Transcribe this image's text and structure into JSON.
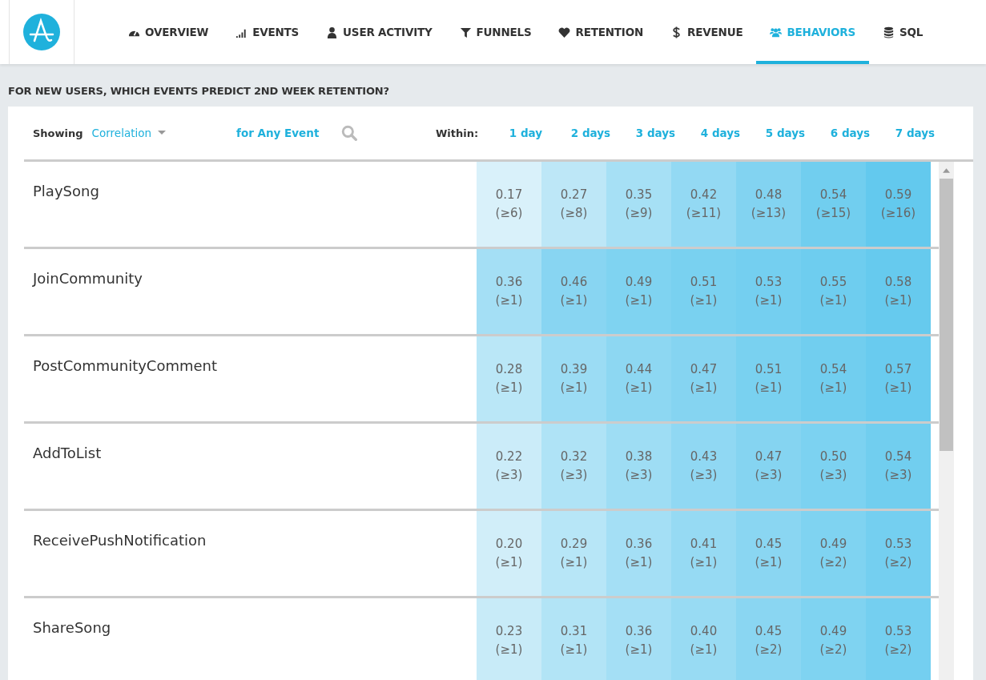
{
  "nav": [
    {
      "label": "OVERVIEW",
      "kind": "gauge",
      "selected": false
    },
    {
      "label": "EVENTS",
      "kind": "bars",
      "selected": false
    },
    {
      "label": "USER ACTIVITY",
      "kind": "user",
      "selected": false
    },
    {
      "label": "FUNNELS",
      "kind": "funnel",
      "selected": false
    },
    {
      "label": "RETENTION",
      "kind": "heart",
      "selected": false
    },
    {
      "label": "REVENUE",
      "kind": "dollar",
      "selected": false
    },
    {
      "label": "BEHAVIORS",
      "kind": "users",
      "selected": true
    },
    {
      "label": "SQL",
      "kind": "database",
      "selected": false
    }
  ],
  "heading": "FOR NEW USERS, WHICH EVENTS PREDICT 2ND WEEK RETENTION?",
  "toolbar": {
    "showing_label": "Showing",
    "metric": "Correlation",
    "event_filter": "for Any Event",
    "within_label": "Within:"
  },
  "columns": [
    "1 day",
    "2 days",
    "3 days",
    "4 days",
    "5 days",
    "6 days",
    "7 days"
  ],
  "rows": [
    {
      "event": "PlaySong",
      "cells": [
        [
          "0.17",
          "(≥6)"
        ],
        [
          "0.27",
          "(≥8)"
        ],
        [
          "0.35",
          "(≥9)"
        ],
        [
          "0.42",
          "(≥11)"
        ],
        [
          "0.48",
          "(≥13)"
        ],
        [
          "0.54",
          "(≥15)"
        ],
        [
          "0.59",
          "(≥16)"
        ]
      ]
    },
    {
      "event": "JoinCommunity",
      "cells": [
        [
          "0.36",
          "(≥1)"
        ],
        [
          "0.46",
          "(≥1)"
        ],
        [
          "0.49",
          "(≥1)"
        ],
        [
          "0.51",
          "(≥1)"
        ],
        [
          "0.53",
          "(≥1)"
        ],
        [
          "0.55",
          "(≥1)"
        ],
        [
          "0.58",
          "(≥1)"
        ]
      ]
    },
    {
      "event": "PostCommunityComment",
      "cells": [
        [
          "0.28",
          "(≥1)"
        ],
        [
          "0.39",
          "(≥1)"
        ],
        [
          "0.44",
          "(≥1)"
        ],
        [
          "0.47",
          "(≥1)"
        ],
        [
          "0.51",
          "(≥1)"
        ],
        [
          "0.54",
          "(≥1)"
        ],
        [
          "0.57",
          "(≥1)"
        ]
      ]
    },
    {
      "event": "AddToList",
      "cells": [
        [
          "0.22",
          "(≥3)"
        ],
        [
          "0.32",
          "(≥3)"
        ],
        [
          "0.38",
          "(≥3)"
        ],
        [
          "0.43",
          "(≥3)"
        ],
        [
          "0.47",
          "(≥3)"
        ],
        [
          "0.50",
          "(≥3)"
        ],
        [
          "0.54",
          "(≥3)"
        ]
      ]
    },
    {
      "event": "ReceivePushNotification",
      "cells": [
        [
          "0.20",
          "(≥1)"
        ],
        [
          "0.29",
          "(≥1)"
        ],
        [
          "0.36",
          "(≥1)"
        ],
        [
          "0.41",
          "(≥1)"
        ],
        [
          "0.45",
          "(≥1)"
        ],
        [
          "0.49",
          "(≥2)"
        ],
        [
          "0.53",
          "(≥2)"
        ]
      ]
    },
    {
      "event": "ShareSong",
      "cells": [
        [
          "0.23",
          "(≥1)"
        ],
        [
          "0.31",
          "(≥1)"
        ],
        [
          "0.36",
          "(≥1)"
        ],
        [
          "0.40",
          "(≥1)"
        ],
        [
          "0.45",
          "(≥2)"
        ],
        [
          "0.49",
          "(≥2)"
        ],
        [
          "0.53",
          "(≥2)"
        ]
      ]
    }
  ]
}
